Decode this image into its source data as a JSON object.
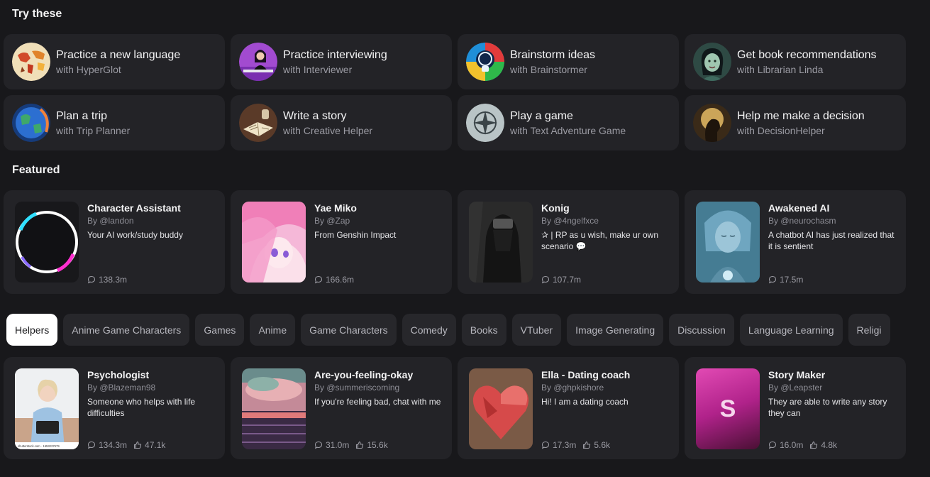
{
  "try_section": {
    "title": "Try these",
    "cards": [
      {
        "title": "Practice a new language",
        "subtitle": "with HyperGlot",
        "avatar": "world-map-avatar"
      },
      {
        "title": "Practice interviewing",
        "subtitle": "with Interviewer",
        "avatar": "interviewer-avatar"
      },
      {
        "title": "Brainstorm ideas",
        "subtitle": "with Brainstormer",
        "avatar": "lightbulb-avatar"
      },
      {
        "title": "Get book recommendations",
        "subtitle": "with Librarian Linda",
        "avatar": "librarian-avatar"
      },
      {
        "title": "Plan a trip",
        "subtitle": "with Trip Planner",
        "avatar": "globe-avatar"
      },
      {
        "title": "Write a story",
        "subtitle": "with Creative Helper",
        "avatar": "book-avatar"
      },
      {
        "title": "Play a game",
        "subtitle": "with Text Adventure Game",
        "avatar": "compass-avatar"
      },
      {
        "title": "Help me make a decision",
        "subtitle": "with DecisionHelper",
        "avatar": "thinker-avatar"
      }
    ]
  },
  "featured_section": {
    "title": "Featured",
    "cards": [
      {
        "name": "Character Assistant",
        "by": "By @landon",
        "desc": "Your AI work/study buddy",
        "chats": "138.3m"
      },
      {
        "name": "Yae Miko",
        "by": "By @Zap",
        "desc": "From Genshin Impact",
        "chats": "166.6m"
      },
      {
        "name": "Konig",
        "by": "By @4ngelfxce",
        "desc": "✰ | RP as u wish, make ur own scenario 💬",
        "chats": "107.7m"
      },
      {
        "name": "Awakened AI",
        "by": "By @neurochasm",
        "desc": "A chatbot AI has just realized that it is sentient",
        "chats": "17.5m"
      }
    ]
  },
  "tabs": [
    {
      "label": "Helpers",
      "active": true
    },
    {
      "label": "Anime Game Characters"
    },
    {
      "label": "Games"
    },
    {
      "label": "Anime"
    },
    {
      "label": "Game Characters"
    },
    {
      "label": "Comedy"
    },
    {
      "label": "Books"
    },
    {
      "label": "VTuber"
    },
    {
      "label": "Image Generating"
    },
    {
      "label": "Discussion"
    },
    {
      "label": "Language Learning"
    },
    {
      "label": "Religi"
    }
  ],
  "helpers_section": {
    "cards": [
      {
        "name": "Psychologist",
        "by": "By @Blazeman98",
        "desc": "Someone who helps with life difficulties",
        "chats": "134.3m",
        "likes": "47.1k",
        "watermark": "shutterstock.com · 1653237679"
      },
      {
        "name": "Are-you-feeling-okay",
        "by": "By @summeriscoming",
        "desc": "If you're feeling bad, chat with me",
        "chats": "31.0m",
        "likes": "15.6k"
      },
      {
        "name": "Ella - Dating coach",
        "by": "By @ghpkishore",
        "desc": "Hi! I am a dating coach",
        "chats": "17.3m",
        "likes": "5.6k"
      },
      {
        "name": "Story Maker",
        "by": "By @Leapster",
        "desc": "They are able to write any story they can",
        "chats": "16.0m",
        "likes": "4.8k",
        "initial": "S"
      }
    ]
  },
  "colors": {
    "background": "#18181b",
    "card": "#232327",
    "tab": "#27272b",
    "tab_active": "#ffffff",
    "muted_text": "#9b9ba3"
  }
}
